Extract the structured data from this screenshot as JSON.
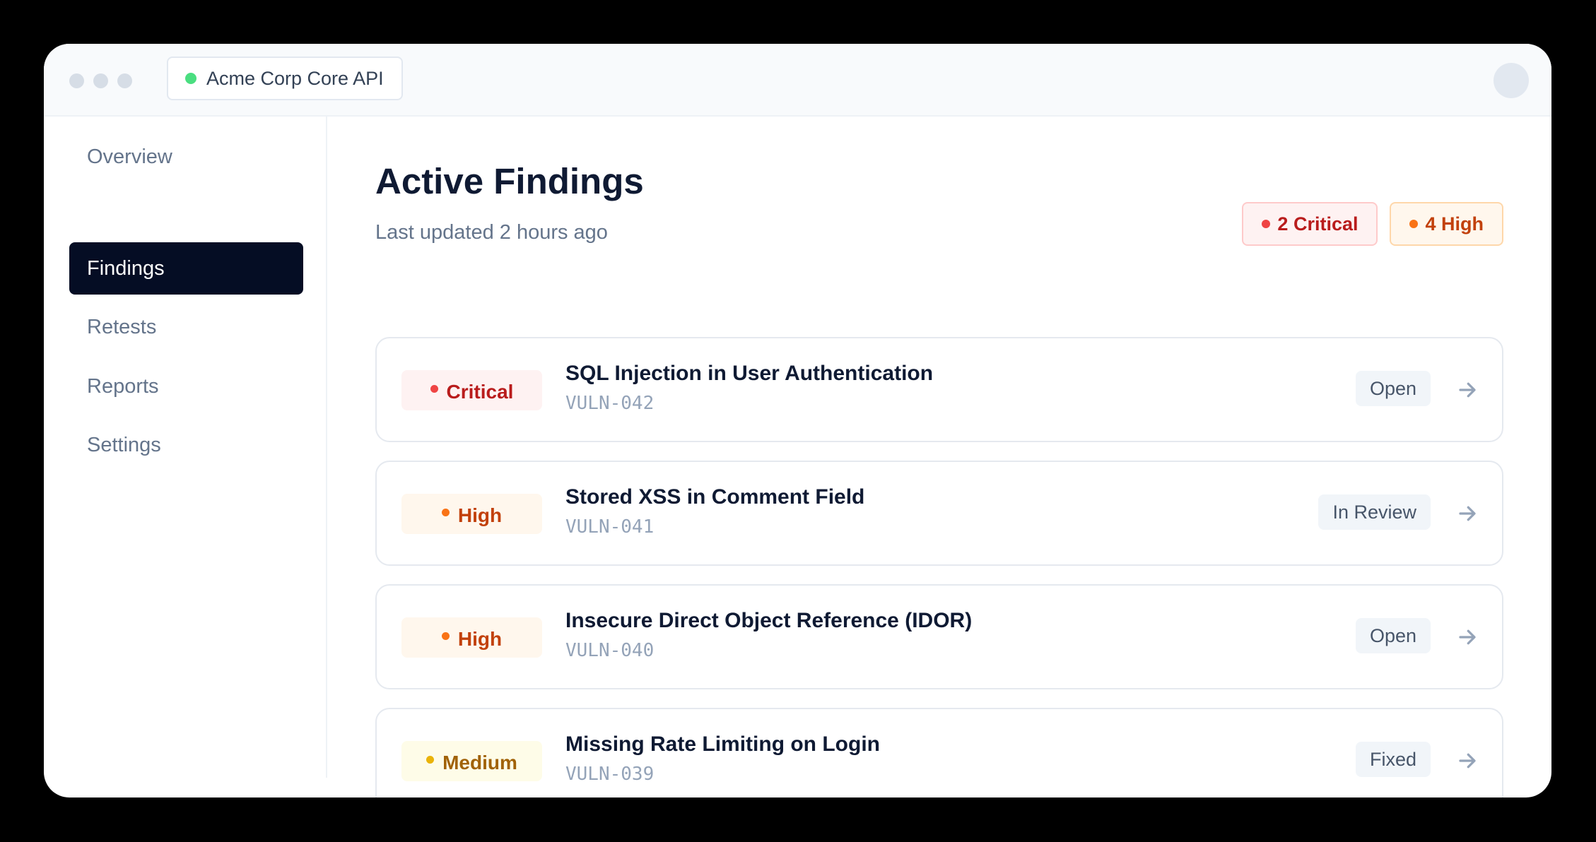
{
  "header": {
    "project_name": "Acme Corp Core API",
    "project_status_color": "#4ade80"
  },
  "sidebar": {
    "items": [
      {
        "label": "Overview",
        "active": false
      },
      {
        "label": "Findings",
        "active": true
      },
      {
        "label": "Retests",
        "active": false
      },
      {
        "label": "Reports",
        "active": false
      },
      {
        "label": "Settings",
        "active": false
      }
    ]
  },
  "main": {
    "title": "Active Findings",
    "subtitle": "Last updated 2 hours ago",
    "summary": {
      "critical_label": "2 Critical",
      "high_label": "4 High"
    },
    "findings": [
      {
        "severity": "Critical",
        "title": "SQL Injection in User Authentication",
        "id": "VULN-042",
        "status": "Open"
      },
      {
        "severity": "High",
        "title": "Stored XSS in Comment Field",
        "id": "VULN-041",
        "status": "In Review"
      },
      {
        "severity": "High",
        "title": "Insecure Direct Object Reference (IDOR)",
        "id": "VULN-040",
        "status": "Open"
      },
      {
        "severity": "Medium",
        "title": "Missing Rate Limiting on Login",
        "id": "VULN-039",
        "status": "Fixed"
      }
    ]
  },
  "colors": {
    "nav_active_bg": "#050d24",
    "critical": "#ef4444",
    "high": "#f97316",
    "medium": "#eab308"
  }
}
